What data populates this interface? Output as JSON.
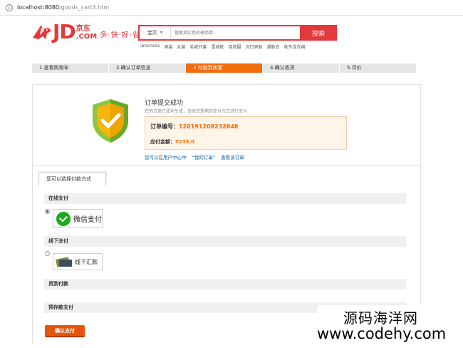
{
  "browser": {
    "url_host": "localhost:8080",
    "url_path": "/goods_cart3.htm"
  },
  "header": {
    "logo_jd": "JD",
    "logo_cn": "京东",
    "logo_com": ".COM",
    "slogan": "多·快·好·省",
    "search": {
      "category": "宝贝",
      "placeholder": "搜索其实真的很简单！",
      "button": "搜索"
    },
    "hotwords": [
      "iphone5s",
      "男装",
      "女装",
      "毛呢外套",
      "雪地靴",
      "羽绒服",
      "流行男鞋",
      "潮鞋衣",
      "秋冬连衣裙"
    ]
  },
  "steps": [
    {
      "label": "1.查看购物车"
    },
    {
      "label": "2.确认订单信息"
    },
    {
      "label": "3.付款到卖家"
    },
    {
      "label": "4.确认收货"
    },
    {
      "label": "5.评价"
    }
  ],
  "active_step": 2,
  "order": {
    "title": "订单提交成功",
    "subtitle": "您的订单已成功生成，选择您想用的支付方式进行支付",
    "number_label": "订单编号：",
    "number": "120191208232848",
    "amount_label": "应付金额：",
    "amount": "¥235.0",
    "links": {
      "prefix": "您可以在用户中心中",
      "my_orders": "“我的订单”",
      "view": "查看该订单"
    }
  },
  "payment": {
    "tab_label": "您可以选择付款方式",
    "online_header": "在线支付",
    "wechat_label": "微信支付",
    "offline_header": "线下支付",
    "offline_label": "线下汇款",
    "cod_header": "货到付款",
    "deposit_header": "预存款支付",
    "confirm_button": "确认支付"
  },
  "watermark": {
    "line1": "源码海洋网",
    "line2": "www.codehy.com"
  },
  "colors": {
    "brand_red": "#e4393c",
    "active_step": "#f36b0b",
    "wechat_green": "#1aad19",
    "link_blue": "#005ea7",
    "confirm_button": "#e4550b"
  }
}
